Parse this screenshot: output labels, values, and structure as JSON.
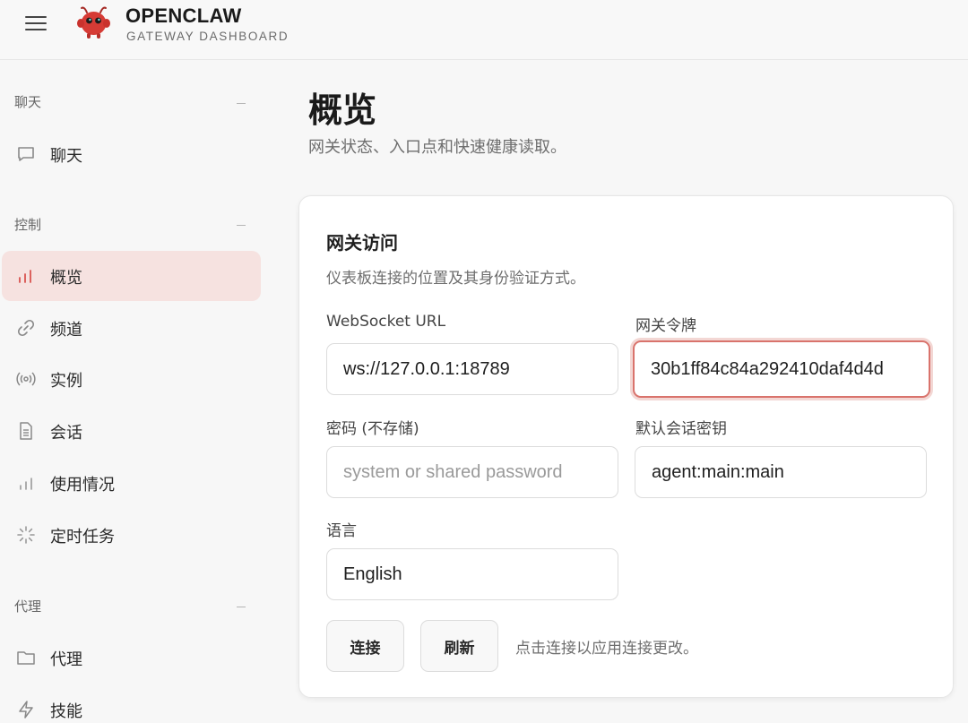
{
  "header": {
    "brand_name": "OPENCLAW",
    "brand_subtitle": "GATEWAY DASHBOARD",
    "menu_icon": "hamburger-icon",
    "logo_icon": "lobster-mascot-icon",
    "brand_color": "#d63b35"
  },
  "sidebar": {
    "sections": [
      {
        "title": "聊天",
        "items": [
          {
            "label": "聊天",
            "icon": "message-icon",
            "active": false
          }
        ]
      },
      {
        "title": "控制",
        "items": [
          {
            "label": "概览",
            "icon": "bar-chart-icon",
            "active": true
          },
          {
            "label": "频道",
            "icon": "link-icon",
            "active": false
          },
          {
            "label": "实例",
            "icon": "radio-broadcast-icon",
            "active": false
          },
          {
            "label": "会话",
            "icon": "document-icon",
            "active": false
          },
          {
            "label": "使用情况",
            "icon": "bar-chart-icon",
            "active": false
          },
          {
            "label": "定时任务",
            "icon": "loader-icon",
            "active": false
          }
        ]
      },
      {
        "title": "代理",
        "items": [
          {
            "label": "代理",
            "icon": "folder-icon",
            "active": false
          },
          {
            "label": "技能",
            "icon": "lightning-icon",
            "active": false
          }
        ]
      }
    ]
  },
  "page": {
    "title": "概览",
    "subtitle": "网关状态、入口点和快速健康读取。"
  },
  "gateway_card": {
    "title": "网关访问",
    "description": "仪表板连接的位置及其身份验证方式。",
    "fields": {
      "websocket_url": {
        "label": "WebSocket URL",
        "value": "ws://127.0.0.1:18789",
        "placeholder": ""
      },
      "gateway_token": {
        "label": "网关令牌",
        "value": "30b1ff84c84a292410daf4d4d",
        "placeholder": ""
      },
      "password": {
        "label": "密码 (不存储)",
        "value": "",
        "placeholder": "system or shared password"
      },
      "default_session_key": {
        "label": "默认会话密钥",
        "value": "agent:main:main",
        "placeholder": ""
      },
      "language": {
        "label": "语言",
        "value": "English"
      }
    },
    "buttons": {
      "connect": "连接",
      "refresh": "刷新"
    },
    "hint": "点击连接以应用连接更改。",
    "focus_color": "#d9736c"
  }
}
